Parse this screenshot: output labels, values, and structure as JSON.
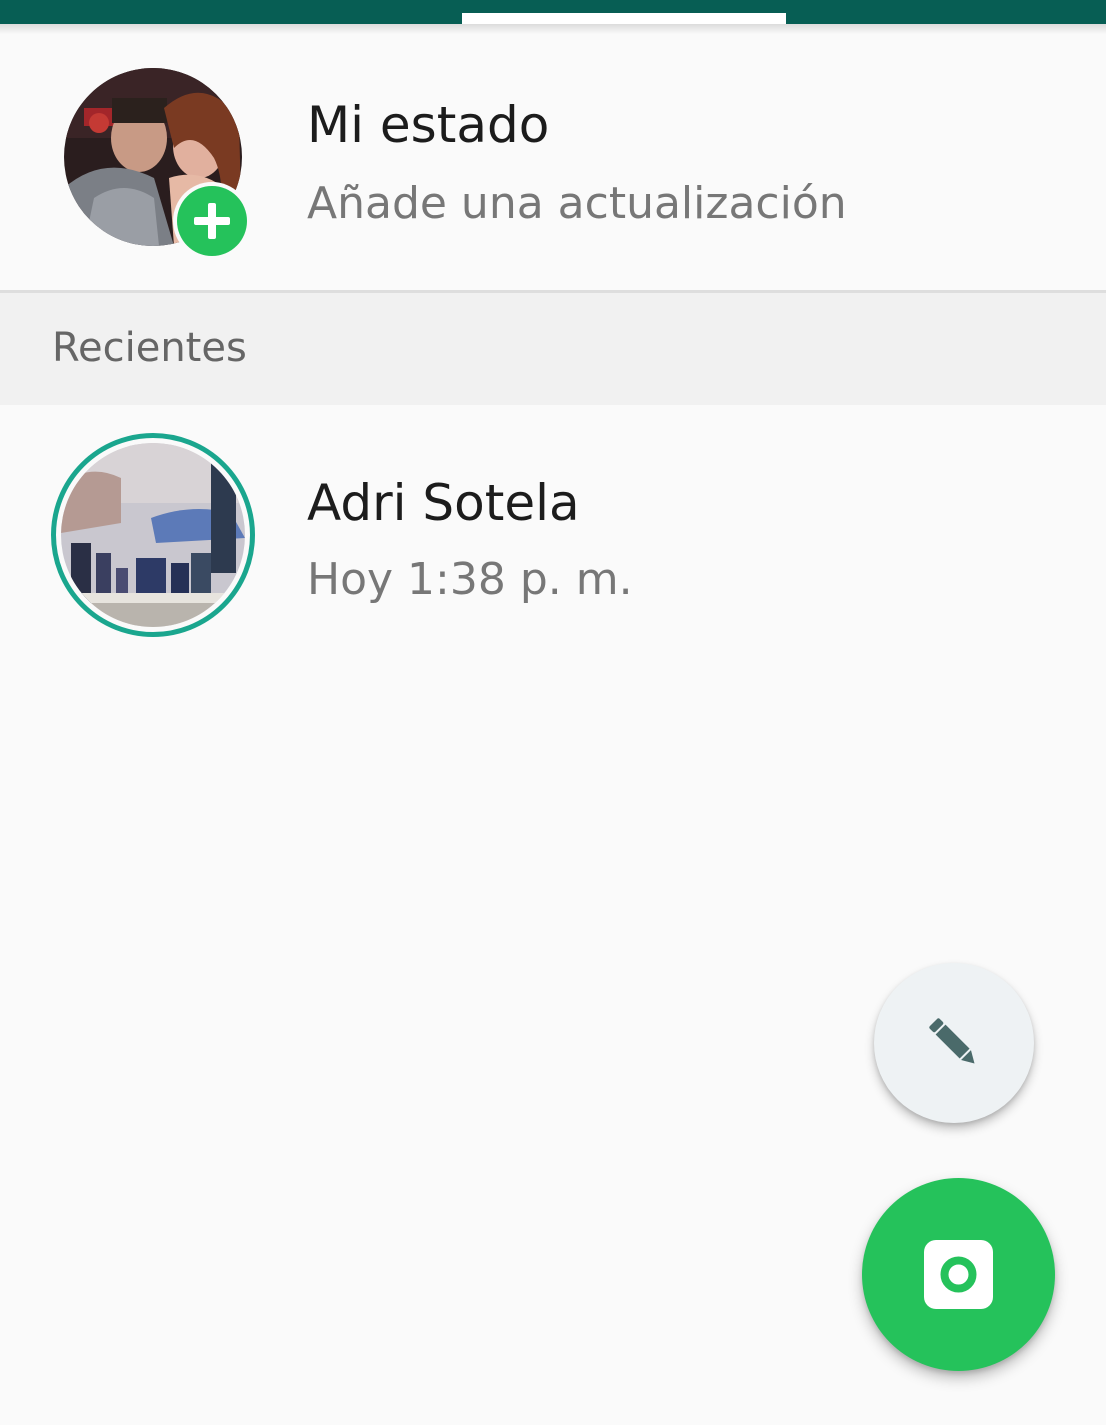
{
  "colors": {
    "header": "#075e54",
    "accent_green": "#25c25b",
    "ring_teal": "#1aa68e",
    "background": "#fafafa",
    "section_background": "#f1f1f1"
  },
  "my_status": {
    "title": "Mi estado",
    "subtitle": "Añade una actualización",
    "avatar_icon": "profile-photo",
    "badge_icon": "plus-icon"
  },
  "section": {
    "label": "Recientes"
  },
  "recent_updates": [
    {
      "name": "Adri Sotela",
      "time": "Hoy 1:38 p. m.",
      "avatar_icon": "status-thumbnail"
    }
  ],
  "fabs": {
    "text_status_icon": "pencil-icon",
    "camera_icon": "camera-icon"
  }
}
